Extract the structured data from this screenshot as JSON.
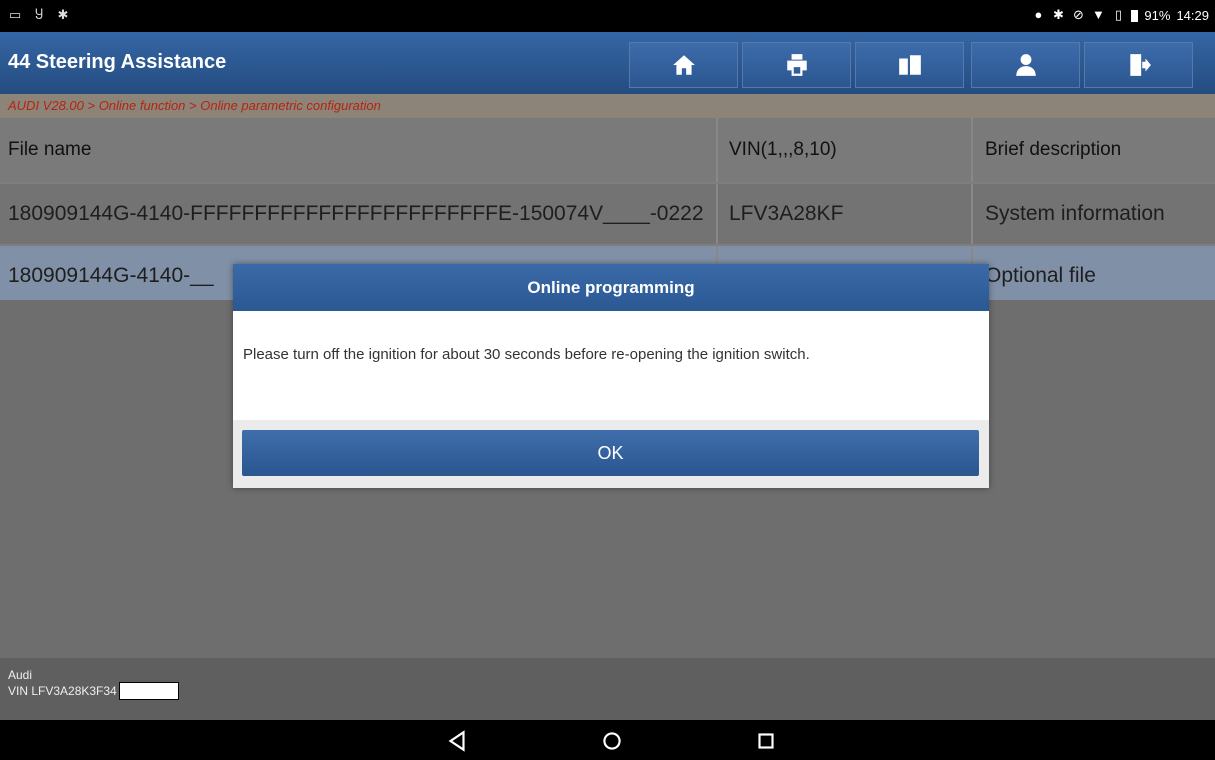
{
  "status_bar": {
    "left_icons": [
      "screenshot-icon",
      "usb-icon",
      "bluetooth-icon"
    ],
    "right_icons": [
      "location-icon",
      "bluetooth-icon",
      "dnd-icon",
      "wifi-icon",
      "sim-icon",
      "battery-icon"
    ],
    "battery": "91%",
    "time": "14:29"
  },
  "header": {
    "title": "44 Steering Assistance",
    "buttons": [
      "home-icon",
      "print-icon",
      "report-icon",
      "user-icon",
      "exit-icon"
    ]
  },
  "breadcrumb": "AUDI V28.00 > Online function > Online parametric configuration",
  "table": {
    "columns": [
      "File name",
      "VIN(1,,,8,10)",
      "Brief description"
    ],
    "rows": [
      [
        "180909144G-4140-FFFFFFFFFFFFFFFFFFFFFFFFE-150074V____-0222",
        "LFV3A28KF",
        "System information"
      ],
      [
        "180909144G-4140-__",
        "",
        "Optional file"
      ]
    ]
  },
  "footer": {
    "make": "Audi",
    "vin": "VIN LFV3A28K3F34"
  },
  "dialog": {
    "title": "Online programming",
    "message": "Please turn off the ignition for about 30 seconds before re-opening the ignition switch.",
    "ok_label": "OK"
  },
  "navbar": [
    "back-icon",
    "home-circle-icon",
    "recents-icon"
  ],
  "colors": {
    "header_blue": "#2b5690",
    "breadcrumb_red": "#b8230f",
    "selected_row": "#8090a6"
  }
}
